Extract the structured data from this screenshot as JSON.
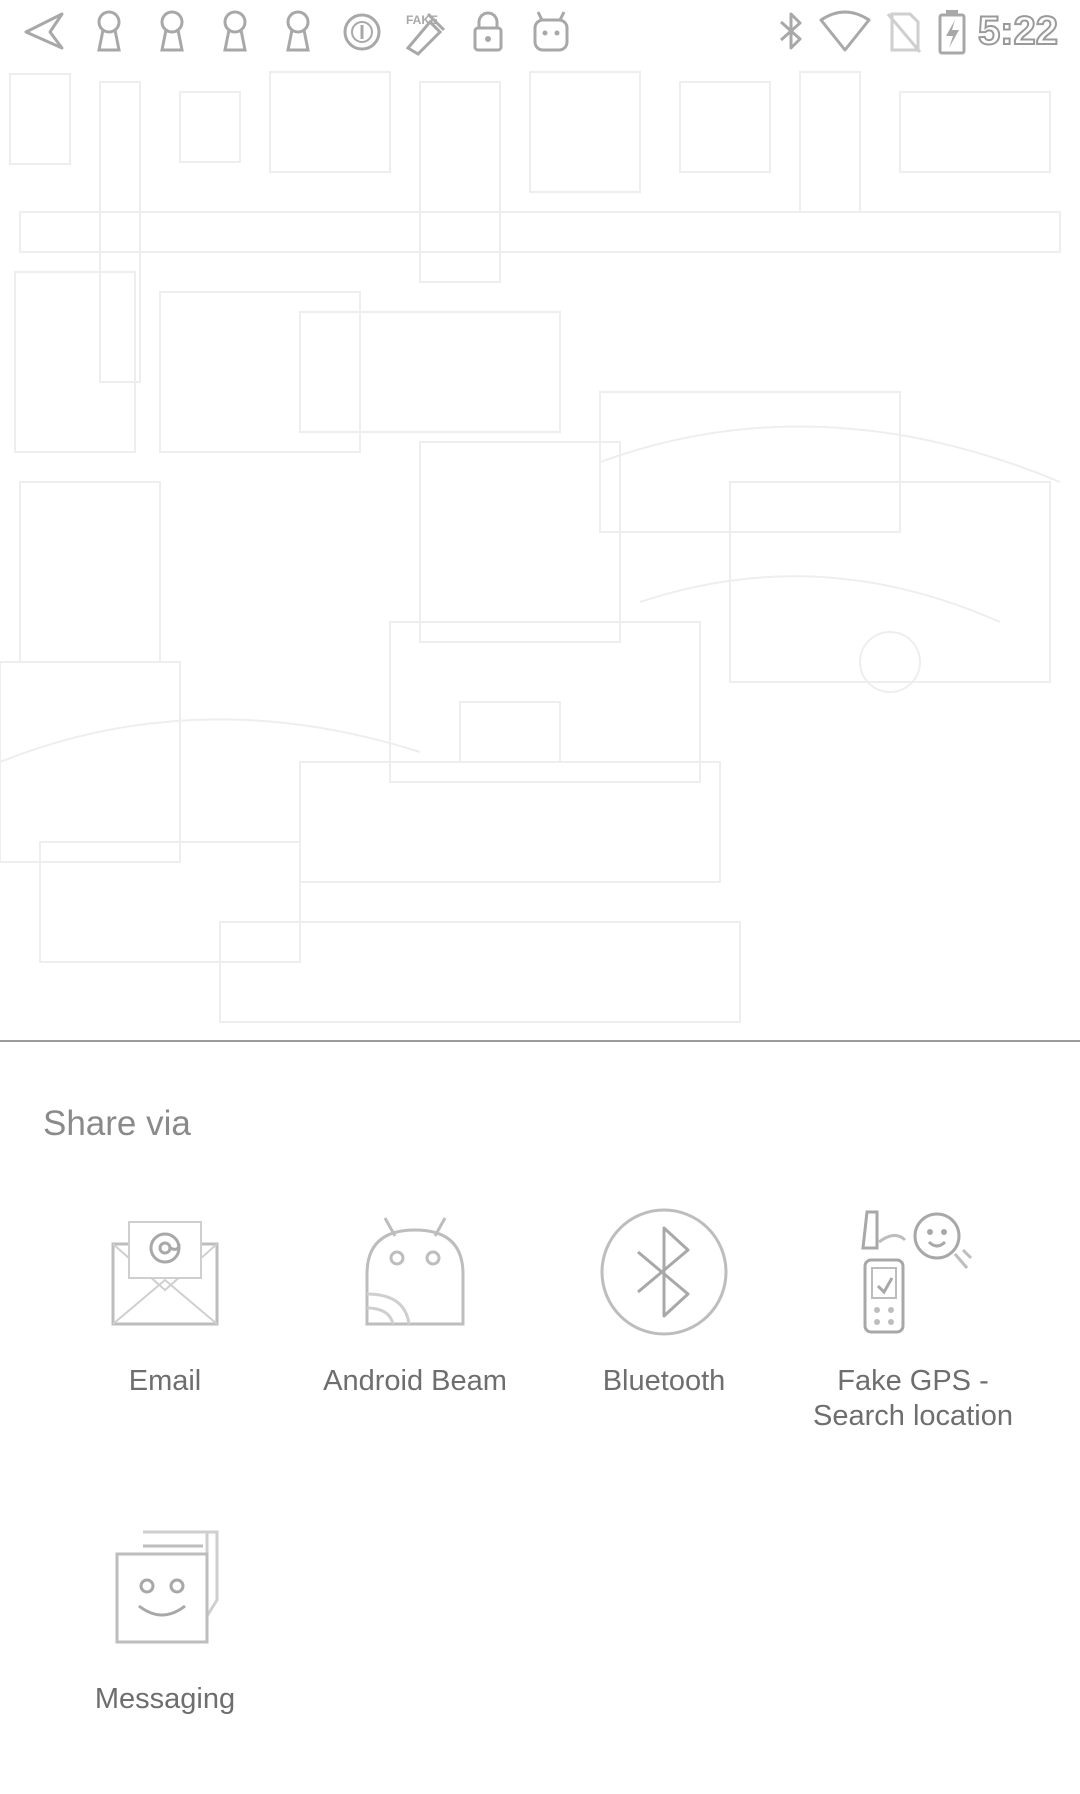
{
  "status_bar": {
    "time": "5:22",
    "left_icons": [
      "back-arrow-icon",
      "keyhole-icon",
      "keyhole-icon",
      "keyhole-icon",
      "keyhole-icon",
      "circle-badge-icon",
      "fake-gps-icon",
      "lock-icon",
      "android-face-icon"
    ],
    "right_icons": [
      "bluetooth-icon",
      "wifi-icon",
      "no-sim-icon",
      "battery-charging-icon"
    ]
  },
  "share_sheet": {
    "title": "Share via",
    "targets": [
      {
        "label": "Email",
        "icon": "email-icon"
      },
      {
        "label": "Android Beam",
        "icon": "android-beam-icon"
      },
      {
        "label": "Bluetooth",
        "icon": "bluetooth-icon"
      },
      {
        "label": "Fake GPS - Search location",
        "icon": "fake-gps-app-icon"
      },
      {
        "label": "Messaging",
        "icon": "messaging-icon"
      }
    ]
  },
  "colors": {
    "icon_stroke": "#b5b5b5",
    "label_text": "#6e6e6e",
    "title_text": "#8a8a8a",
    "divider": "#9c9c9c"
  }
}
